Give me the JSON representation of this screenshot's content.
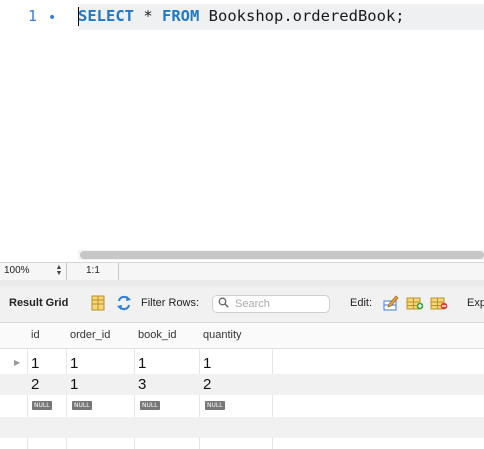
{
  "editor": {
    "line_number": "1",
    "line_marker": "•",
    "code_parts": {
      "kw1": "SELECT",
      "star": " * ",
      "kw2": "FROM",
      "rest": " Bookshop.orderedBook;"
    }
  },
  "status_bar": {
    "zoom": "100%",
    "cursor_position": "1:1"
  },
  "toolbar": {
    "result_grid_label": "Result Grid",
    "filter_rows_label": "Filter Rows:",
    "search_placeholder": "Search",
    "edit_label": "Edit:",
    "export_label": "Exp"
  },
  "grid": {
    "columns": [
      "id",
      "order_id",
      "book_id",
      "quantity"
    ],
    "rows": [
      [
        "1",
        "1",
        "1",
        "1"
      ],
      [
        "2",
        "1",
        "3",
        "2"
      ]
    ],
    "null_label": "NULL"
  },
  "colors": {
    "keyword": "#1f78c8",
    "line_number": "#3b7dd8",
    "null_badge": "#777777"
  }
}
